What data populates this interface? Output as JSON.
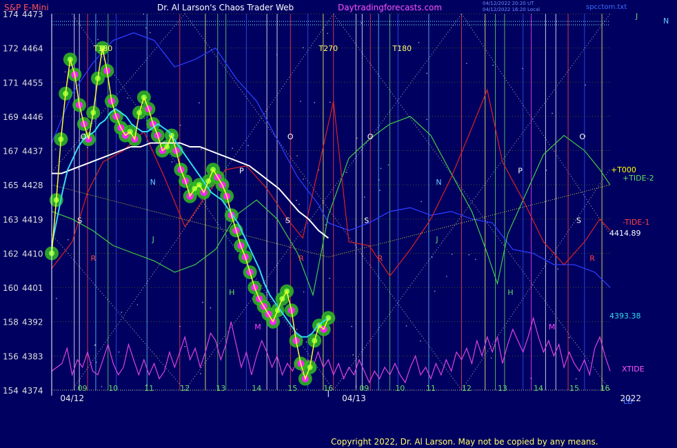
{
  "header": {
    "symbol": "S&P E-Mini",
    "title": "Dr. Al Larson's Chaos Trader Web",
    "site": "Daytradingforecasts.com",
    "stamp_line1": "04/12/2022 20:20 UT",
    "stamp_line2": "04/12/2022 16:20 Local",
    "filename": "spcctom.txt"
  },
  "copyright": "Copyright 2022, Dr. Al Larson. May not be copied by any means.",
  "chart_data": {
    "type": "line",
    "y_ticks": [
      {
        "left": "174",
        "right": "4473"
      },
      {
        "left": "172",
        "right": "4464"
      },
      {
        "left": "171",
        "right": "4455"
      },
      {
        "left": "169",
        "right": "4446"
      },
      {
        "left": "167",
        "right": "4437"
      },
      {
        "left": "165",
        "right": "4428"
      },
      {
        "left": "163",
        "right": "4419"
      },
      {
        "left": "162",
        "right": "4410"
      },
      {
        "left": "160",
        "right": "4401"
      },
      {
        "left": "158",
        "right": "4392"
      },
      {
        "left": "156",
        "right": "4383"
      },
      {
        "left": "154",
        "right": "4374"
      }
    ],
    "ylim": [
      4374,
      4473
    ],
    "xlim": [
      0,
      27.5
    ],
    "x_hour_labels": [
      {
        "x": 3,
        "label": "09"
      },
      {
        "x": 6,
        "label": "10"
      },
      {
        "x": 9.5,
        "label": "11"
      },
      {
        "x": 13,
        "label": "12"
      },
      {
        "x": 16.5,
        "label": "13"
      },
      {
        "x": 20,
        "label": "14"
      },
      {
        "x": 23.5,
        "label": "15"
      },
      {
        "x": 27,
        "label": "16"
      },
      {
        "x": 30.5,
        "label": "09"
      },
      {
        "x": 34,
        "label": "10"
      },
      {
        "x": 37,
        "label": "11"
      },
      {
        "x": 40.5,
        "label": "12"
      },
      {
        "x": 44,
        "label": "13"
      },
      {
        "x": 47.5,
        "label": "14"
      },
      {
        "x": 51,
        "label": "15"
      },
      {
        "x": 54,
        "label": "16"
      }
    ],
    "x_date_labels": [
      {
        "x": 2,
        "label": "04/12"
      },
      {
        "x": 29.5,
        "label": "04/13"
      },
      {
        "x": 56.5,
        "label": "2022"
      }
    ],
    "x_extent": [
      0,
      54.5
    ],
    "price_5min": [
      4410,
      4424,
      4440,
      4452,
      4461,
      4457,
      4449,
      4444,
      4440,
      4447,
      4456,
      4464,
      4458,
      4450,
      4446,
      4443,
      4441,
      4442,
      4440,
      4447,
      4451,
      4448,
      4444,
      4441,
      4437,
      4438,
      4441,
      4437,
      4432,
      4429,
      4425,
      4427,
      4428,
      4426,
      4429,
      4432,
      4430,
      4428,
      4425,
      4420,
      4416,
      4412,
      4409,
      4405,
      4401,
      4398,
      4396,
      4394,
      4392,
      4395,
      4398,
      4400,
      4395,
      4387,
      4381,
      4377,
      4380,
      4387,
      4391,
      4390,
      4393
    ],
    "price_end_label": "4393.38",
    "ma_fast": [
      4412,
      4419,
      4426,
      4432,
      4435,
      4438,
      4440,
      4441,
      4442,
      4444,
      4445,
      4447,
      4448,
      4447,
      4446,
      4444,
      4443,
      4442,
      4442,
      4443,
      4444,
      4443,
      4442,
      4440,
      4438,
      4436,
      4434,
      4432,
      4430,
      4428,
      4426,
      4425,
      4424,
      4422,
      4420,
      4418,
      4415,
      4412,
      4409,
      4406,
      4402,
      4399,
      4397,
      4395,
      4393,
      4391,
      4389,
      4388,
      4388,
      4389,
      4391,
      4392,
      4393
    ],
    "ma_slow": [
      4431,
      4431,
      4432,
      4433,
      4434,
      4435,
      4436,
      4437,
      4438,
      4438,
      4439,
      4439,
      4439,
      4439,
      4438,
      4438,
      4437,
      4436,
      4435,
      4434,
      4433,
      4431,
      4429,
      4427,
      4424,
      4421,
      4419,
      4416,
      4414
    ],
    "xtide_end_label": "XTIDE",
    "tide_labels": [
      {
        "label": "+T000",
        "color": "#ffff00"
      },
      {
        "label": "+TIDE-2",
        "color": "#66dd66"
      },
      {
        "label": "-TIDE-1",
        "color": "#ff4444"
      },
      {
        "label": "4414.89",
        "color": "#ffffff"
      }
    ],
    "tide2_green": [
      [
        0,
        4421
      ],
      [
        2,
        4419
      ],
      [
        4,
        4416
      ],
      [
        6,
        4412
      ],
      [
        8,
        4410
      ],
      [
        10,
        4408
      ],
      [
        12,
        4405
      ],
      [
        14,
        4407
      ],
      [
        16,
        4411
      ],
      [
        18,
        4420
      ],
      [
        20,
        4424
      ],
      [
        22,
        4419
      ],
      [
        24,
        4410
      ],
      [
        25.5,
        4399
      ],
      [
        27,
        4420
      ],
      [
        29,
        4435
      ],
      [
        31,
        4440
      ],
      [
        33,
        4444
      ],
      [
        35,
        4446
      ],
      [
        37,
        4441
      ],
      [
        39,
        4431
      ],
      [
        41,
        4421
      ],
      [
        42.5,
        4410
      ],
      [
        43.5,
        4402
      ],
      [
        44.5,
        4415
      ],
      [
        46,
        4424
      ],
      [
        48,
        4436
      ],
      [
        50,
        4441
      ],
      [
        52,
        4437
      ],
      [
        53.5,
        4432
      ],
      [
        54.5,
        4428
      ]
    ],
    "tide1_red": [
      [
        0,
        4406
      ],
      [
        2,
        4413
      ],
      [
        3.5,
        4426
      ],
      [
        5,
        4434
      ],
      [
        7,
        4437
      ],
      [
        9,
        4442
      ],
      [
        11,
        4430
      ],
      [
        13,
        4417
      ],
      [
        15,
        4425
      ],
      [
        17,
        4432
      ],
      [
        19,
        4433
      ],
      [
        21,
        4427
      ],
      [
        23,
        4419
      ],
      [
        24.5,
        4414
      ],
      [
        26,
        4432
      ],
      [
        27.5,
        4450
      ],
      [
        29,
        4413
      ],
      [
        31,
        4412
      ],
      [
        33,
        4404
      ],
      [
        35,
        4411
      ],
      [
        37,
        4419
      ],
      [
        39,
        4430
      ],
      [
        41,
        4443
      ],
      [
        42.5,
        4453
      ],
      [
        44,
        4434
      ],
      [
        46,
        4424
      ],
      [
        48,
        4413
      ],
      [
        50,
        4407
      ],
      [
        52,
        4413
      ],
      [
        53.5,
        4419
      ],
      [
        54.5,
        4416
      ]
    ],
    "blue_line": [
      [
        0,
        4439
      ],
      [
        2,
        4452
      ],
      [
        4,
        4460
      ],
      [
        6,
        4466
      ],
      [
        8,
        4468
      ],
      [
        10,
        4466
      ],
      [
        12,
        4459
      ],
      [
        14,
        4461
      ],
      [
        16,
        4464
      ],
      [
        18,
        4456
      ],
      [
        20,
        4450
      ],
      [
        22,
        4440
      ],
      [
        24,
        4430
      ],
      [
        26,
        4423
      ],
      [
        27,
        4418
      ],
      [
        29,
        4416
      ],
      [
        31,
        4418
      ],
      [
        33,
        4421
      ],
      [
        35,
        4422
      ],
      [
        37,
        4420
      ],
      [
        39,
        4421
      ],
      [
        41,
        4419
      ],
      [
        43,
        4418
      ],
      [
        45,
        4411
      ],
      [
        47,
        4410
      ],
      [
        49,
        4407
      ],
      [
        51,
        4407
      ],
      [
        53,
        4405
      ],
      [
        54.5,
        4401
      ]
    ],
    "xtide": [
      [
        0,
        4379
      ],
      [
        1,
        4381
      ],
      [
        1.5,
        4385
      ],
      [
        2,
        4378
      ],
      [
        2.5,
        4382
      ],
      [
        3,
        4380
      ],
      [
        3.5,
        4384
      ],
      [
        4,
        4379
      ],
      [
        4.5,
        4378
      ],
      [
        5,
        4382
      ],
      [
        5.5,
        4386
      ],
      [
        6,
        4381
      ],
      [
        6.5,
        4378
      ],
      [
        7,
        4380
      ],
      [
        7.5,
        4386
      ],
      [
        8,
        4382
      ],
      [
        8.5,
        4378
      ],
      [
        9,
        4382
      ],
      [
        9.5,
        4378
      ],
      [
        10,
        4381
      ],
      [
        10.5,
        4377
      ],
      [
        11,
        4379
      ],
      [
        11.5,
        4384
      ],
      [
        12,
        4380
      ],
      [
        12.5,
        4384
      ],
      [
        13,
        4388
      ],
      [
        13.5,
        4382
      ],
      [
        14,
        4385
      ],
      [
        14.5,
        4380
      ],
      [
        15,
        4384
      ],
      [
        15.5,
        4389
      ],
      [
        16,
        4387
      ],
      [
        16.5,
        4382
      ],
      [
        17,
        4386
      ],
      [
        17.5,
        4392
      ],
      [
        18,
        4386
      ],
      [
        18.5,
        4380
      ],
      [
        19,
        4384
      ],
      [
        19.5,
        4378
      ],
      [
        20,
        4383
      ],
      [
        20.5,
        4387
      ],
      [
        21,
        4384
      ],
      [
        21.5,
        4380
      ],
      [
        22,
        4383
      ],
      [
        22.5,
        4378
      ],
      [
        23,
        4381
      ],
      [
        23.5,
        4379
      ],
      [
        24,
        4382
      ],
      [
        24.5,
        4378
      ],
      [
        25,
        4382
      ],
      [
        25.5,
        4380
      ],
      [
        26,
        4384
      ],
      [
        26.5,
        4380
      ],
      [
        27,
        4382
      ],
      [
        27.5,
        4378
      ],
      [
        28,
        4381
      ],
      [
        28.5,
        4377
      ],
      [
        29,
        4380
      ],
      [
        29.5,
        4378
      ],
      [
        30,
        4382
      ],
      [
        30.5,
        4379
      ],
      [
        31,
        4376
      ],
      [
        31.5,
        4379
      ],
      [
        32,
        4377
      ],
      [
        32.5,
        4380
      ],
      [
        33,
        4378
      ],
      [
        33.5,
        4381
      ],
      [
        34,
        4378
      ],
      [
        34.5,
        4376
      ],
      [
        35,
        4380
      ],
      [
        35.5,
        4383
      ],
      [
        36,
        4378
      ],
      [
        36.5,
        4380
      ],
      [
        37,
        4377
      ],
      [
        37.5,
        4381
      ],
      [
        38,
        4378
      ],
      [
        38.5,
        4382
      ],
      [
        39,
        4379
      ],
      [
        39.5,
        4384
      ],
      [
        40,
        4382
      ],
      [
        40.5,
        4385
      ],
      [
        41,
        4381
      ],
      [
        41.5,
        4387
      ],
      [
        42,
        4383
      ],
      [
        42.5,
        4388
      ],
      [
        43,
        4384
      ],
      [
        43.5,
        4388
      ],
      [
        44,
        4381
      ],
      [
        44.5,
        4386
      ],
      [
        45,
        4390
      ],
      [
        45.5,
        4387
      ],
      [
        46,
        4384
      ],
      [
        46.5,
        4388
      ],
      [
        47,
        4393
      ],
      [
        47.5,
        4388
      ],
      [
        48,
        4384
      ],
      [
        48.5,
        4387
      ],
      [
        49,
        4383
      ],
      [
        49.5,
        4386
      ],
      [
        50,
        4380
      ],
      [
        50.5,
        4384
      ],
      [
        51,
        4381
      ],
      [
        51.5,
        4379
      ],
      [
        52,
        4382
      ],
      [
        52.5,
        4378
      ],
      [
        53,
        4385
      ],
      [
        53.5,
        4388
      ],
      [
        54,
        4383
      ],
      [
        54.5,
        4379
      ]
    ],
    "t000_line": [
      [
        0,
        4428
      ],
      [
        27,
        4409
      ],
      [
        54.5,
        4428
      ]
    ],
    "letter_marks": [
      {
        "x": 2.8,
        "y": 4440,
        "label": "O",
        "color": "#ffffff"
      },
      {
        "x": 2.5,
        "y": 4418,
        "label": "S",
        "color": "#ffffff"
      },
      {
        "x": 3.8,
        "y": 4408,
        "label": "R",
        "color": "#ff4444"
      },
      {
        "x": 9.6,
        "y": 4428,
        "label": "N",
        "color": "#66ccff"
      },
      {
        "x": 9.8,
        "y": 4413,
        "label": "J",
        "color": "#66dd66"
      },
      {
        "x": 17.3,
        "y": 4399,
        "label": "H",
        "color": "#66dd66"
      },
      {
        "x": 18.3,
        "y": 4431,
        "label": "P",
        "color": "#ffffff"
      },
      {
        "x": 23,
        "y": 4440,
        "label": "O",
        "color": "#ffffff"
      },
      {
        "x": 22.8,
        "y": 4418,
        "label": "S",
        "color": "#ffffff"
      },
      {
        "x": 24.1,
        "y": 4408,
        "label": "R",
        "color": "#ff4444"
      },
      {
        "x": 19.8,
        "y": 4390,
        "label": "M",
        "color": "#ff44ff"
      },
      {
        "x": 30.8,
        "y": 4440,
        "label": "O",
        "color": "#ffffff"
      },
      {
        "x": 30.5,
        "y": 4418,
        "label": "S",
        "color": "#ffffff"
      },
      {
        "x": 31.8,
        "y": 4408,
        "label": "R",
        "color": "#ff4444"
      },
      {
        "x": 37.5,
        "y": 4428,
        "label": "N",
        "color": "#66ccff"
      },
      {
        "x": 37.5,
        "y": 4413,
        "label": "J",
        "color": "#66dd66"
      },
      {
        "x": 44.5,
        "y": 4399,
        "label": "H",
        "color": "#66dd66"
      },
      {
        "x": 45.5,
        "y": 4431,
        "label": "P",
        "color": "#ffffff"
      },
      {
        "x": 48.5,
        "y": 4390,
        "label": "M",
        "color": "#ff44ff"
      },
      {
        "x": 51.5,
        "y": 4440,
        "label": "O",
        "color": "#ffffff"
      },
      {
        "x": 51.2,
        "y": 4418,
        "label": "S",
        "color": "#ffffff"
      },
      {
        "x": 52.5,
        "y": 4408,
        "label": "R",
        "color": "#ff4444"
      }
    ],
    "t_labels": [
      {
        "x": 5,
        "label": "T180"
      },
      {
        "x": 27,
        "label": "T270"
      },
      {
        "x": 34.2,
        "label": "T180"
      }
    ],
    "vlines": [
      {
        "x": 2.2,
        "color": "#ffffff"
      },
      {
        "x": 2.7,
        "color": "#ffffff"
      },
      {
        "x": 3.5,
        "color": "#ff4444"
      },
      {
        "x": 4.3,
        "color": "#66ccff"
      },
      {
        "x": 5.5,
        "color": "#66dd66"
      },
      {
        "x": 6.3,
        "color": "#3355ff"
      },
      {
        "x": 9.3,
        "color": "#66ccff"
      },
      {
        "x": 12.5,
        "color": "#ff4444"
      },
      {
        "x": 15,
        "color": "#ffff66"
      },
      {
        "x": 16.2,
        "color": "#66dd66"
      },
      {
        "x": 17,
        "color": "#66dd66"
      },
      {
        "x": 19,
        "color": "#3355ff"
      },
      {
        "x": 21,
        "color": "#ffffff"
      },
      {
        "x": 22,
        "color": "#ffffff"
      },
      {
        "x": 23.3,
        "color": "#ff4444"
      },
      {
        "x": 25,
        "color": "#3355ff"
      },
      {
        "x": 26.5,
        "color": "#ffff66"
      },
      {
        "x": 27.5,
        "color": "#ff4444"
      },
      {
        "x": 29.7,
        "color": "#ffffff"
      },
      {
        "x": 30.3,
        "color": "#ffffff"
      },
      {
        "x": 31.1,
        "color": "#ff4444"
      },
      {
        "x": 31.9,
        "color": "#66ccff"
      },
      {
        "x": 33,
        "color": "#66dd66"
      },
      {
        "x": 33.8,
        "color": "#3355ff"
      },
      {
        "x": 36.8,
        "color": "#66ccff"
      },
      {
        "x": 40,
        "color": "#ff4444"
      },
      {
        "x": 42.3,
        "color": "#ffff66"
      },
      {
        "x": 43.3,
        "color": "#66dd66"
      },
      {
        "x": 44.2,
        "color": "#66dd66"
      },
      {
        "x": 46,
        "color": "#3355ff"
      },
      {
        "x": 46.8,
        "color": "#ff44ff"
      },
      {
        "x": 48.2,
        "color": "#ffffff"
      },
      {
        "x": 49.2,
        "color": "#ffffff"
      },
      {
        "x": 50.4,
        "color": "#ff4444"
      },
      {
        "x": 52,
        "color": "#3355ff"
      },
      {
        "x": 53.7,
        "color": "#ffff66"
      }
    ],
    "right_top_labels": [
      {
        "label": "J",
        "color": "#66dd66"
      },
      {
        "label": "N",
        "color": "#66ccff"
      }
    ],
    "bottom_right_label": "LB",
    "grid": true
  }
}
